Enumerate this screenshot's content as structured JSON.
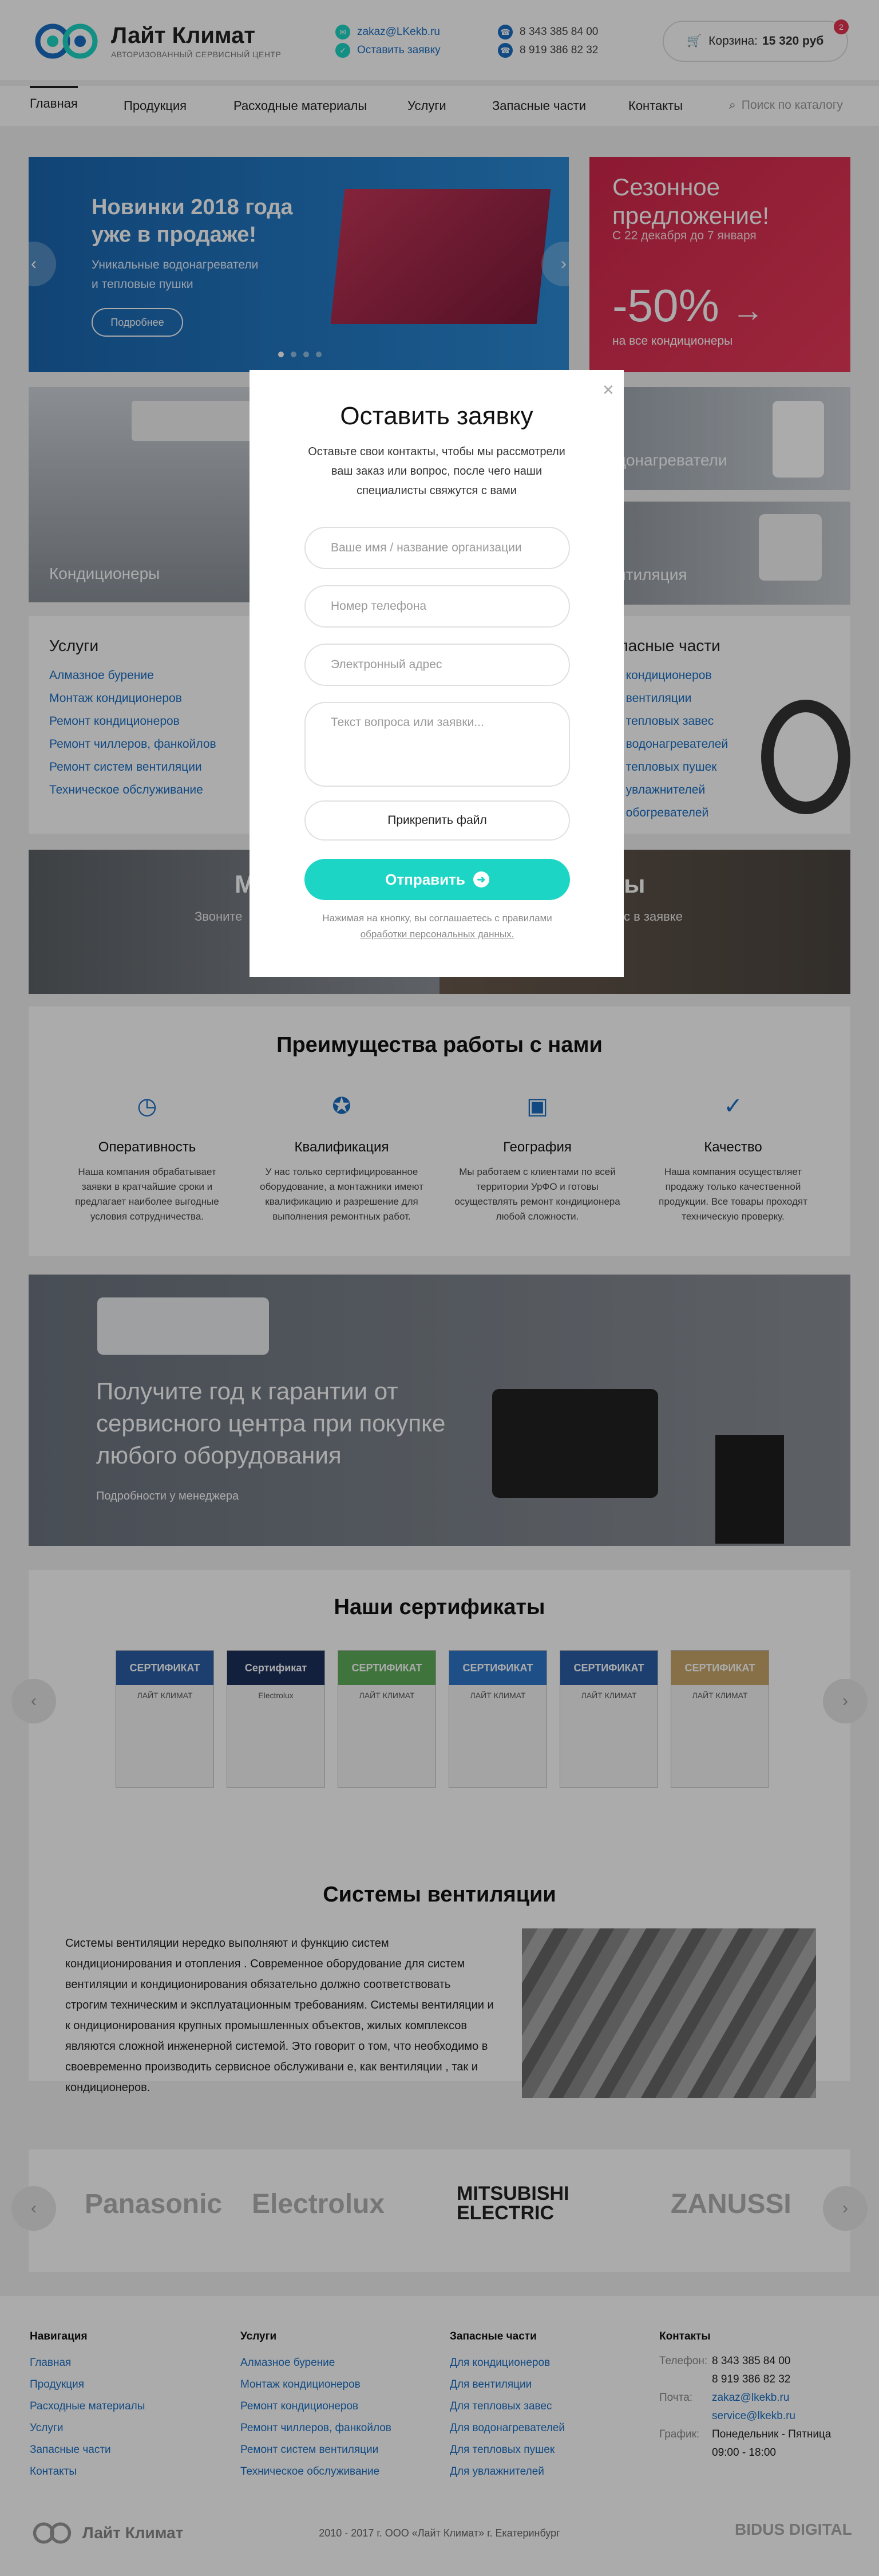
{
  "header": {
    "logo_title": "Лайт Климат",
    "logo_sub": "АВТОРИЗОВАННЫЙ СЕРВИСНЫЙ ЦЕНТР",
    "email": "zakaz@LKekb.ru",
    "request_link": "Оставить заявку",
    "phone1": "8 343 385 84 00",
    "phone2": "8 919 386 82 32",
    "cart_label": "Корзина:",
    "cart_total": "15 320 руб",
    "cart_count": "2"
  },
  "nav": {
    "items": [
      "Главная",
      "Продукция",
      "Расходные материалы",
      "Услуги",
      "Запасные части",
      "Контакты"
    ],
    "search_placeholder": "Поиск по каталогу"
  },
  "banner": {
    "title_line1": "Новинки 2018 года",
    "title_line2": "уже в продаже!",
    "sub_line1": "Уникальные водонагреватели",
    "sub_line2": "и тепловые пушки",
    "button": "Подробнее"
  },
  "promo": {
    "title_line1": "Сезонное",
    "title_line2": "предложение!",
    "dates": "С 22 декабря до 7 января",
    "discount": "-50%",
    "note": "на все кондиционеры"
  },
  "tiles": {
    "conditioners": "Кондиционеры",
    "water_heaters": "Водонагреватели",
    "ventilation": "Вентиляция"
  },
  "services": {
    "title": "Услуги",
    "items": [
      "Алмазное бурение",
      "Монтаж кондиционеров",
      "Ремонт кондиционеров",
      "Ремонт чиллеров, фанкойлов",
      "Ремонт систем вентиляции",
      "Техническое обслуживание"
    ]
  },
  "parts": {
    "title": "Запасные части",
    "items": [
      "Для кондиционеров",
      "Для вентиляции",
      "Для тепловых завес",
      "Для водонагревателей",
      "Для тепловых пушек",
      "Для увлажнителей",
      "Для обогревателей"
    ]
  },
  "call": {
    "left_title": "М",
    "left_sub": "Звоните",
    "right_title": "ы",
    "right_sub": "с в заявке"
  },
  "advantages": {
    "title": "Преимущества работы с нами",
    "items": [
      {
        "name": "Оперативность",
        "desc": "Наша компания обрабатывает заявки в кратчайшие сроки и предлагает наиболее выгодные условия сотрудничества."
      },
      {
        "name": "Квалификация",
        "desc": "У нас только сертифицированное оборудование, а монтажники имеют квалификацию и разрешение для выполнения ремонтных работ."
      },
      {
        "name": "География",
        "desc": "Мы работаем с клиентами по всей территории УрФО и готовы осуществлять ремонт кондиционера любой сложности."
      },
      {
        "name": "Качество",
        "desc": "Наша компания осуществляет продажу только качественной продукции. Все товары проходят техническую проверку."
      }
    ]
  },
  "warranty": {
    "title_line1": "Получите год к гарантии от",
    "title_line2": "сервисного центра при покупке",
    "title_line3": "любого оборудования",
    "link": "Подробности у менеджера"
  },
  "certificates": {
    "title": "Наши сертификаты",
    "items": [
      "СЕРТИФИКАТ",
      "Сертификат",
      "СЕРТИФИКАТ",
      "СЕРТИФИКАТ",
      "СЕРТИФИКАТ",
      "СЕРТИФИКАТ"
    ]
  },
  "ventilation": {
    "title": "Системы вентиляции",
    "text": "Системы вентиляции нередко выполняют и функцию систем кондиционирования и отопления . Современное оборудование для систем вентиляции и кондиционирования обязательно должно соответствовать строгим техническим и эксплуатационным требованиям. Системы вентиляции и к ондиционирования крупных промышленных объектов, жилых комплексов являются сложной инженерной системой. Это говорит о том, что необходимо в своевременно производить сервисное обслуживани е, как вентиляции , так и кондиционеров."
  },
  "brands": [
    "Panasonic",
    "Electrolux",
    "MITSUBISHI ELECTRIC",
    "ZANUSSI"
  ],
  "footer": {
    "nav_title": "Навигация",
    "nav_items": [
      "Главная",
      "Продукция",
      "Расходные материалы",
      "Услуги",
      "Запасные части",
      "Контакты"
    ],
    "services_title": "Услуги",
    "services_items": [
      "Алмазное бурение",
      "Монтаж кондиционеров",
      "Ремонт кондиционеров",
      "Ремонт чиллеров, фанкойлов",
      "Ремонт систем вентиляции",
      "Техническое обслуживание"
    ],
    "parts_title": "Запасные части",
    "parts_items": [
      "Для кондиционеров",
      "Для вентиляции",
      "Для тепловых завес",
      "Для водонагревателей",
      "Для тепловых пушек",
      "Для увлажнителей"
    ],
    "contacts_title": "Контакты",
    "phone_label": "Телефон:",
    "phone1": "8 343 385 84 00",
    "phone2": "8 919 386 82 32",
    "mail_label": "Почта:",
    "mail1": "zakaz@lkekb.ru",
    "mail2": "service@lkekb.ru",
    "schedule_label": "График:",
    "schedule1": "Понедельник - Пятница",
    "schedule2": "09:00 - 18:00",
    "copyright": "2010 - 2017 г. ООО «Лайт Климат» г. Екатеринбург",
    "logo": "Лайт Климат",
    "dev": "BIDUS DIGITAL"
  },
  "modal": {
    "title": "Оставить заявку",
    "desc": "Оставьте свои контакты, чтобы мы рассмотрели ваш заказ или вопрос, после чего наши специалисты свяжутся с вами",
    "name_placeholder": "Ваше имя / название организации",
    "phone_placeholder": "Номер телефона",
    "email_placeholder": "Электронный адрес",
    "question_placeholder": "Текст вопроса или заявки...",
    "attach": "Прикрепить файл",
    "submit": "Отправить",
    "note": "Нажимая на кнопку, вы соглашаетесь с правилами",
    "note_link": "обработки персональных данных."
  },
  "colors": {
    "accent": "#1dd5c5",
    "link": "#1a6fc4",
    "promo": "#d0274a",
    "badge": "#e53350"
  }
}
